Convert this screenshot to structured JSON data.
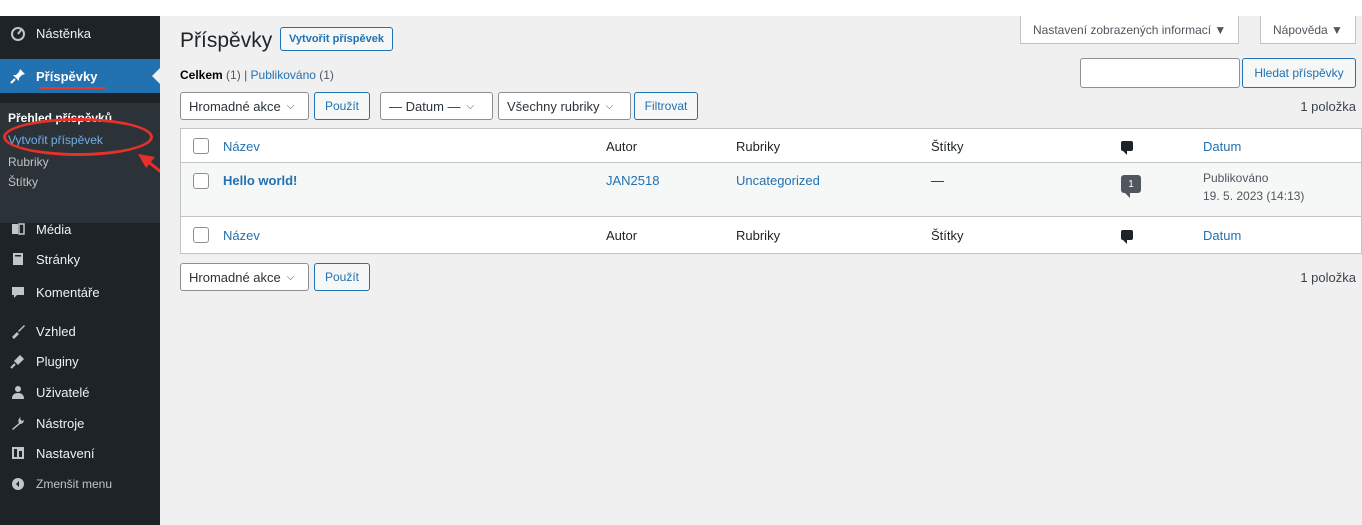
{
  "sidebar": {
    "items": [
      {
        "label": "Nástěnka",
        "icon": "dashboard-icon"
      },
      {
        "label": "Příspěvky",
        "icon": "pin-icon"
      },
      {
        "label": "Média",
        "icon": "media-icon"
      },
      {
        "label": "Stránky",
        "icon": "pages-icon"
      },
      {
        "label": "Komentáře",
        "icon": "comments-icon"
      },
      {
        "label": "Vzhled",
        "icon": "appearance-icon"
      },
      {
        "label": "Pluginy",
        "icon": "plugins-icon"
      },
      {
        "label": "Uživatelé",
        "icon": "users-icon"
      },
      {
        "label": "Nástroje",
        "icon": "tools-icon"
      },
      {
        "label": "Nastavení",
        "icon": "settings-icon"
      },
      {
        "label": "Zmenšit menu",
        "icon": "collapse-icon"
      }
    ],
    "submenu": [
      "Přehled příspěvků",
      "Vytvořit příspěvek",
      "Rubriky",
      "Štítky"
    ]
  },
  "screen_meta": {
    "screen_options": "Nastavení zobrazených informací ▼",
    "help": "Nápověda ▼"
  },
  "header": {
    "title": "Příspěvky",
    "add_new": "Vytvořit příspěvek"
  },
  "filters": {
    "all_label": "Celkem",
    "all_count": "(1)",
    "separator": "|",
    "published_label": "Publikováno",
    "published_count": "(1)"
  },
  "search": {
    "placeholder": "",
    "button": "Hledat příspěvky"
  },
  "tablenav": {
    "bulk_actions": "Hromadné akce",
    "apply": "Použít",
    "date_filter": "— Datum —",
    "category_filter": "Všechny rubriky",
    "filter_button": "Filtrovat",
    "item_count": "1 položka"
  },
  "table": {
    "columns": [
      "Název",
      "Autor",
      "Rubriky",
      "Štítky",
      "",
      "Datum"
    ],
    "rows": [
      {
        "title": "Hello world!",
        "author": "JAN2518",
        "categories": "Uncategorized",
        "tags": "—",
        "comments": "1",
        "status": "Publikováno",
        "date": "19. 5. 2023 (14:13)"
      }
    ]
  },
  "colors": {
    "sidebar_bg": "#1d2327",
    "accent": "#2271b1",
    "annotation": "#e8302a"
  }
}
